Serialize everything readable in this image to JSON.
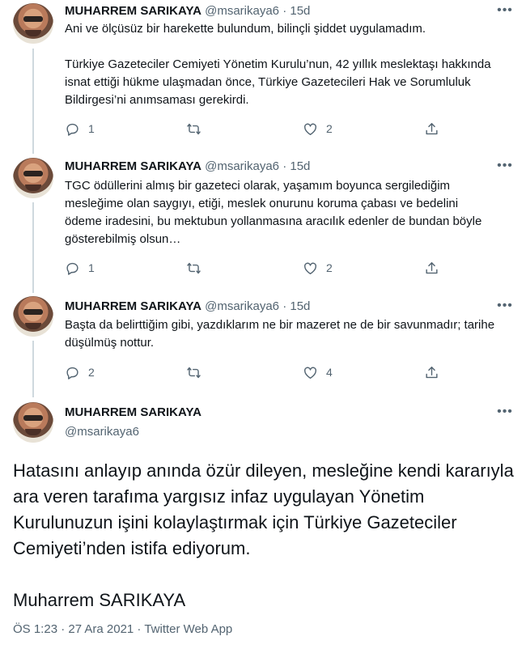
{
  "thread": [
    {
      "name": "MUHARREM SARIKAYA",
      "handle": "@msarikaya6",
      "dot": "·",
      "time": "15d",
      "text": "Ani ve ölçüsüz bir harekette bulundum, bilinçli şiddet uygulamadım.\n\nTürkiye Gazeteciler Cemiyeti Yönetim Kurulu’nun, 42 yıllık meslektaşı hakkında isnat ettiği hükme ulaşmadan önce, Türkiye Gazetecileri Hak ve Sorumluluk Bildirgesi’ni anımsaması gerekirdi.",
      "replies": "1",
      "retweets": "",
      "likes": "2"
    },
    {
      "name": "MUHARREM SARIKAYA",
      "handle": "@msarikaya6",
      "dot": "·",
      "time": "15d",
      "text": "TGC ödüllerini almış bir gazeteci olarak, yaşamım boyunca sergilediğim mesleğime olan saygıyı, etiği, meslek onurunu koruma çabası ve bedelini ödeme iradesini, bu mektubun yollanmasına aracılık edenler de bundan böyle gösterebilmiş olsun…",
      "replies": "1",
      "retweets": "",
      "likes": "2"
    },
    {
      "name": "MUHARREM SARIKAYA",
      "handle": "@msarikaya6",
      "dot": "·",
      "time": "15d",
      "text": "Başta da belirttiğim gibi, yazdıklarım ne bir mazeret ne de bir savunmadır; tarihe düşülmüş nottur.",
      "replies": "2",
      "retweets": "",
      "likes": "4"
    }
  ],
  "main": {
    "name": "MUHARREM SARIKAYA",
    "handle": "@msarikaya6",
    "text": "Hatasını anlayıp anında özür dileyen, mesleğine kendi kararıyla ara veren tarafıma yargısız infaz uygulayan Yönetim Kurulunuzun işini kolaylaştırmak için Türkiye Gazeteciler Cemiyeti’nden istifa ediyorum.\n\nMuharrem SARIKAYA",
    "meta": "ÖS 1:23 · 27 Ara 2021 · Twitter Web App"
  },
  "icons": {
    "reply": "reply-icon",
    "retweet": "retweet-icon",
    "like": "heart-icon",
    "share": "share-icon",
    "more": "more-icon"
  },
  "colors": {
    "text": "#0f1419",
    "secondary": "#536471",
    "thread_line": "#cfd9de"
  }
}
